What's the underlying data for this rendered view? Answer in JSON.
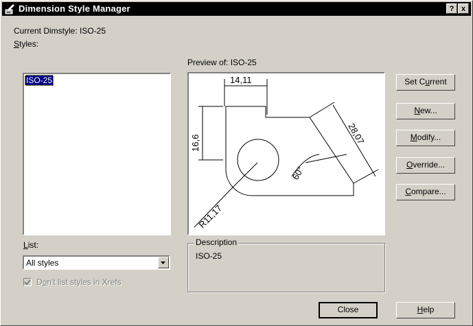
{
  "window": {
    "title": "Dimension Style Manager",
    "help_btn": "?",
    "close_btn": "x"
  },
  "current_style": {
    "label": "Current Dimstyle: ISO-25"
  },
  "styles": {
    "label_prefix": "",
    "label_hotkey": "S",
    "label_rest": "tyles:",
    "items": [
      "ISO-25"
    ],
    "selected": "ISO-25"
  },
  "preview": {
    "label": "Preview of: ISO-25",
    "dims": {
      "top": "14,11",
      "left": "16,6",
      "diag": "28,07",
      "angle": "60°",
      "radius": "R11,17"
    }
  },
  "buttons": {
    "set_current_pre": "Set C",
    "set_current_hot": "u",
    "set_current_post": "rrent",
    "new_hot": "N",
    "new_post": "ew...",
    "modify_hot": "M",
    "modify_post": "odify...",
    "override_hot": "O",
    "override_post": "verride...",
    "compare_hot": "C",
    "compare_post": "ompare...",
    "close": "Close",
    "help_hot": "H",
    "help_post": "elp"
  },
  "list": {
    "label_hotkey": "L",
    "label_rest": "ist:",
    "value": "All styles"
  },
  "xrefs": {
    "label_pre": "D",
    "label_hot": "o",
    "label_post": "n't list styles in Xrefs",
    "checked": true
  },
  "description": {
    "label": "Description",
    "text": "ISO-25"
  }
}
